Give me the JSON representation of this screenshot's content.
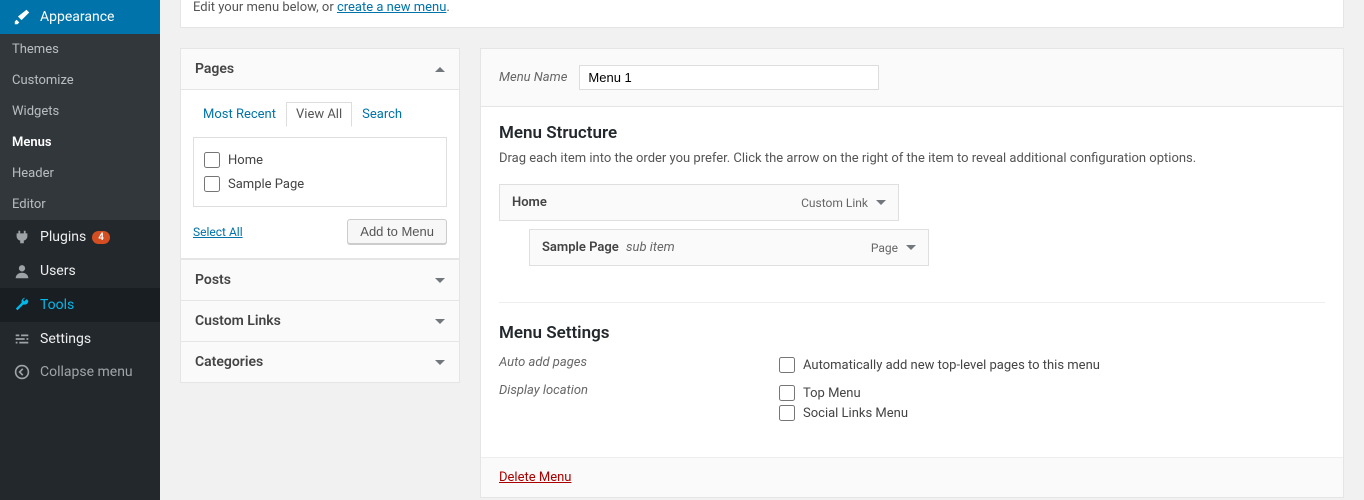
{
  "sidebar": {
    "appearance_label": "Appearance",
    "sub": {
      "themes": "Themes",
      "customize": "Customize",
      "widgets": "Widgets",
      "menus": "Menus",
      "header": "Header",
      "editor": "Editor"
    },
    "plugins_label": "Plugins",
    "plugins_count": "4",
    "users_label": "Users",
    "tools_label": "Tools",
    "settings_label": "Settings",
    "collapse_label": "Collapse menu"
  },
  "topbar": {
    "text_left": "Edit your menu below, or ",
    "link": "create a new menu",
    "text_right": "."
  },
  "accordion": {
    "pages_label": "Pages",
    "tabs": {
      "recent": "Most Recent",
      "all": "View All",
      "search": "Search"
    },
    "items": {
      "home": "Home",
      "sample": "Sample Page"
    },
    "select_all": "Select All",
    "add_btn": "Add to Menu",
    "posts_label": "Posts",
    "custom_label": "Custom Links",
    "cats_label": "Categories"
  },
  "editor": {
    "name_label": "Menu Name",
    "name_value": "Menu 1",
    "structure_heading": "Menu Structure",
    "structure_desc": "Drag each item into the order you prefer. Click the arrow on the right of the item to reveal additional configuration options.",
    "items": {
      "home": {
        "label": "Home",
        "type": "Custom Link"
      },
      "sample": {
        "label": "Sample Page",
        "subnote": "sub item",
        "type": "Page"
      }
    },
    "settings_heading": "Menu Settings",
    "auto_label": "Auto add pages",
    "auto_option": "Automatically add new top-level pages to this menu",
    "loc_label": "Display location",
    "loc_top": "Top Menu",
    "loc_social": "Social Links Menu",
    "delete": "Delete Menu"
  }
}
